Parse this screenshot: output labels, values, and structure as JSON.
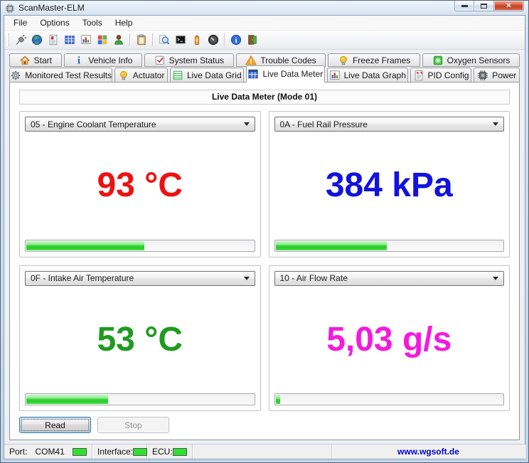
{
  "window": {
    "title": "ScanMaster-ELM",
    "icon": "chip",
    "controls": {
      "minimize": "minimize",
      "maximize": "maximize",
      "close": "✕"
    }
  },
  "menu": {
    "items": [
      "File",
      "Options",
      "Tools",
      "Help"
    ]
  },
  "toolbar": {
    "groups": [
      [
        "connect",
        "globe",
        "report",
        "data-grid",
        "data-graph",
        "window-colors",
        "user"
      ],
      [
        "clipboard"
      ],
      [
        "search",
        "terminal",
        "battery",
        "gauge"
      ],
      [
        "info",
        "exit"
      ]
    ]
  },
  "tabs": {
    "row1": [
      {
        "icon": "home",
        "label": "Start"
      },
      {
        "icon": "vehicle-info",
        "label": "Vehicle Info"
      },
      {
        "icon": "system-status",
        "label": "System Status"
      },
      {
        "icon": "trouble-codes",
        "label": "Trouble Codes"
      },
      {
        "icon": "freeze-frames",
        "label": "Freeze Frames"
      },
      {
        "icon": "oxygen-sensors",
        "label": "Oxygen Sensors"
      }
    ],
    "row2": [
      {
        "icon": "monitored-tests",
        "label": "Monitored Test Results"
      },
      {
        "icon": "actuator",
        "label": "Actuator"
      },
      {
        "icon": "live-data-grid",
        "label": "Live Data Grid"
      },
      {
        "icon": "live-data-meter",
        "label": "Live Data Meter",
        "active": true
      },
      {
        "icon": "live-data-graph",
        "label": "Live Data Graph"
      },
      {
        "icon": "pid-config",
        "label": "PID Config"
      },
      {
        "icon": "power",
        "label": "Power"
      }
    ]
  },
  "main": {
    "header": "Live Data Meter (Mode 01)",
    "meters": [
      {
        "pid": "05 - Engine Coolant Temperature",
        "value": "93 °C",
        "color": "#EE1111",
        "progress": 52
      },
      {
        "pid": "0A - Fuel Rail Pressure",
        "value": "384 kPa",
        "color": "#1212DD",
        "progress": 49
      },
      {
        "pid": "0F - Intake Air Temperature",
        "value": "53 °C",
        "color": "#1E9B1E",
        "progress": 36
      },
      {
        "pid": "10 - Air Flow Rate",
        "value": "5,03 g/s",
        "color": "#F619DD",
        "progress": 2
      }
    ]
  },
  "actions": {
    "read": "Read",
    "stop": "Stop"
  },
  "statusbar": {
    "port_label": "Port:",
    "port_value": "COM41",
    "interface_label": "Interface:",
    "ecu_label": "ECU:",
    "led_color": "#30E030",
    "website": "www.wgsoft.de"
  }
}
